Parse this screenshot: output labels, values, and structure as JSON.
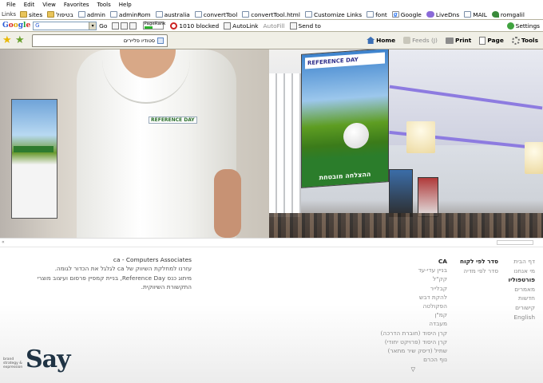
{
  "menubar": {
    "items": [
      "File",
      "Edit",
      "View",
      "Favorites",
      "Tools",
      "Help"
    ]
  },
  "links_bar": {
    "label": "Links",
    "items": [
      {
        "label": "sites",
        "icon": "folder-icon"
      },
      {
        "label": "בטיפול",
        "icon": "folder-icon"
      },
      {
        "label": "admin",
        "icon": "page-icon"
      },
      {
        "label": "adminRom",
        "icon": "page-icon"
      },
      {
        "label": "australia",
        "icon": "page-icon"
      },
      {
        "label": "convertTool",
        "icon": "page-icon"
      },
      {
        "label": "convertTool.html",
        "icon": "page-icon"
      },
      {
        "label": "Customize Links",
        "icon": "page-icon"
      },
      {
        "label": "font",
        "icon": "page-icon"
      },
      {
        "label": "Google",
        "icon": "google-icon"
      },
      {
        "label": "LiveDns",
        "icon": "livedns-icon"
      },
      {
        "label": "MAIL",
        "icon": "page-icon"
      },
      {
        "label": "romgalil",
        "icon": "bird-icon"
      }
    ]
  },
  "google_toolbar": {
    "logo": "Google",
    "search_value": "G",
    "go_label": "Go",
    "pagerank_label": "PageRank",
    "blocked_label": "1010 blocked",
    "autolink_label": "AutoLink",
    "autofill_label": "AutoFill",
    "send_label": "Send to",
    "settings_label": "Settings"
  },
  "tabbar": {
    "tab_title": "סטודיו פליירים",
    "commands": {
      "home": "Home",
      "feeds": "Feeds (J)",
      "print": "Print",
      "page": "Page",
      "tools": "Tools"
    }
  },
  "photos": {
    "shirt_logo": "REFERENCE DAY",
    "banner_header": "REFERENCE DAY",
    "banner_footer": "ההצלחה מובטחת"
  },
  "nav": {
    "primary": [
      {
        "label": "דף הבית",
        "active": false
      },
      {
        "label": "מי אנחנו",
        "active": false
      },
      {
        "label": "פורטפוליו",
        "active": true
      },
      {
        "label": "מאמרים",
        "active": false
      },
      {
        "label": "חדשות",
        "active": false
      },
      {
        "label": "קישורים",
        "active": false
      },
      {
        "label": "English",
        "active": false
      }
    ],
    "secondary": [
      {
        "label": "סדר לפי לקוח",
        "head": true
      },
      {
        "label": "סדר לפי מדיה",
        "head": false
      }
    ],
    "clients": [
      {
        "label": "CA",
        "head": true
      },
      {
        "label": "בניין עדי-עד",
        "head": false
      },
      {
        "label": "קק\"ל",
        "head": false
      },
      {
        "label": "קבלייר",
        "head": false
      },
      {
        "label": "להקת דבש",
        "head": false
      },
      {
        "label": "הפקולטה",
        "head": false
      },
      {
        "label": "קמ\"ן",
        "head": false
      },
      {
        "label": "מעבדה",
        "head": false
      },
      {
        "label": "קרן היסוד (חוברת הדרכה)",
        "head": false
      },
      {
        "label": "קרן היסוד (פרויקט יחודי)",
        "head": false
      },
      {
        "label": "שתיל (דיסק שיר מתאר)",
        "head": false
      },
      {
        "label": "נוף הכרם",
        "head": false
      }
    ],
    "scroll_arrow": "▽"
  },
  "description": {
    "title": "ca - Computers Associates",
    "line1": "עזרנו למחלקת השיווק של ca לגלגל את הכדור לגומה.",
    "line2": "מיתוג כנס Reference Day, בניית קמפיין פרסום ועיצוב מוצרי",
    "line3": "התקשורת השיווקית."
  },
  "logo": {
    "word": "Say",
    "tagline": "brand strategy & expression"
  }
}
